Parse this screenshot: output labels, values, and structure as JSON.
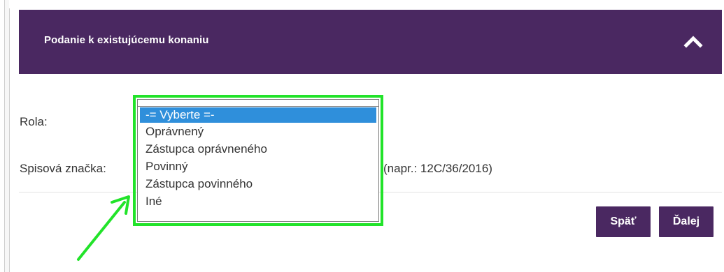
{
  "panel": {
    "title": "Podanie k existujúcemu konaniu",
    "collapse_icon": "chevron-up-icon"
  },
  "form": {
    "rola_label": "Rola:",
    "spisova_label": "Spisová značka:",
    "spisova_hint": "(napr.: 12C/36/2016)",
    "rola_dropdown": {
      "options": [
        "-= Vyberte =-",
        "Oprávnený",
        "Zástupca oprávneného",
        "Povinný",
        "Zástupca povinného",
        "Iné"
      ],
      "selected_index": 0
    }
  },
  "buttons": {
    "back": "Späť",
    "next": "Ďalej"
  },
  "colors": {
    "header_bg": "#4a2861",
    "highlight": "#22e32a",
    "selected_option": "#2f8fdb"
  }
}
